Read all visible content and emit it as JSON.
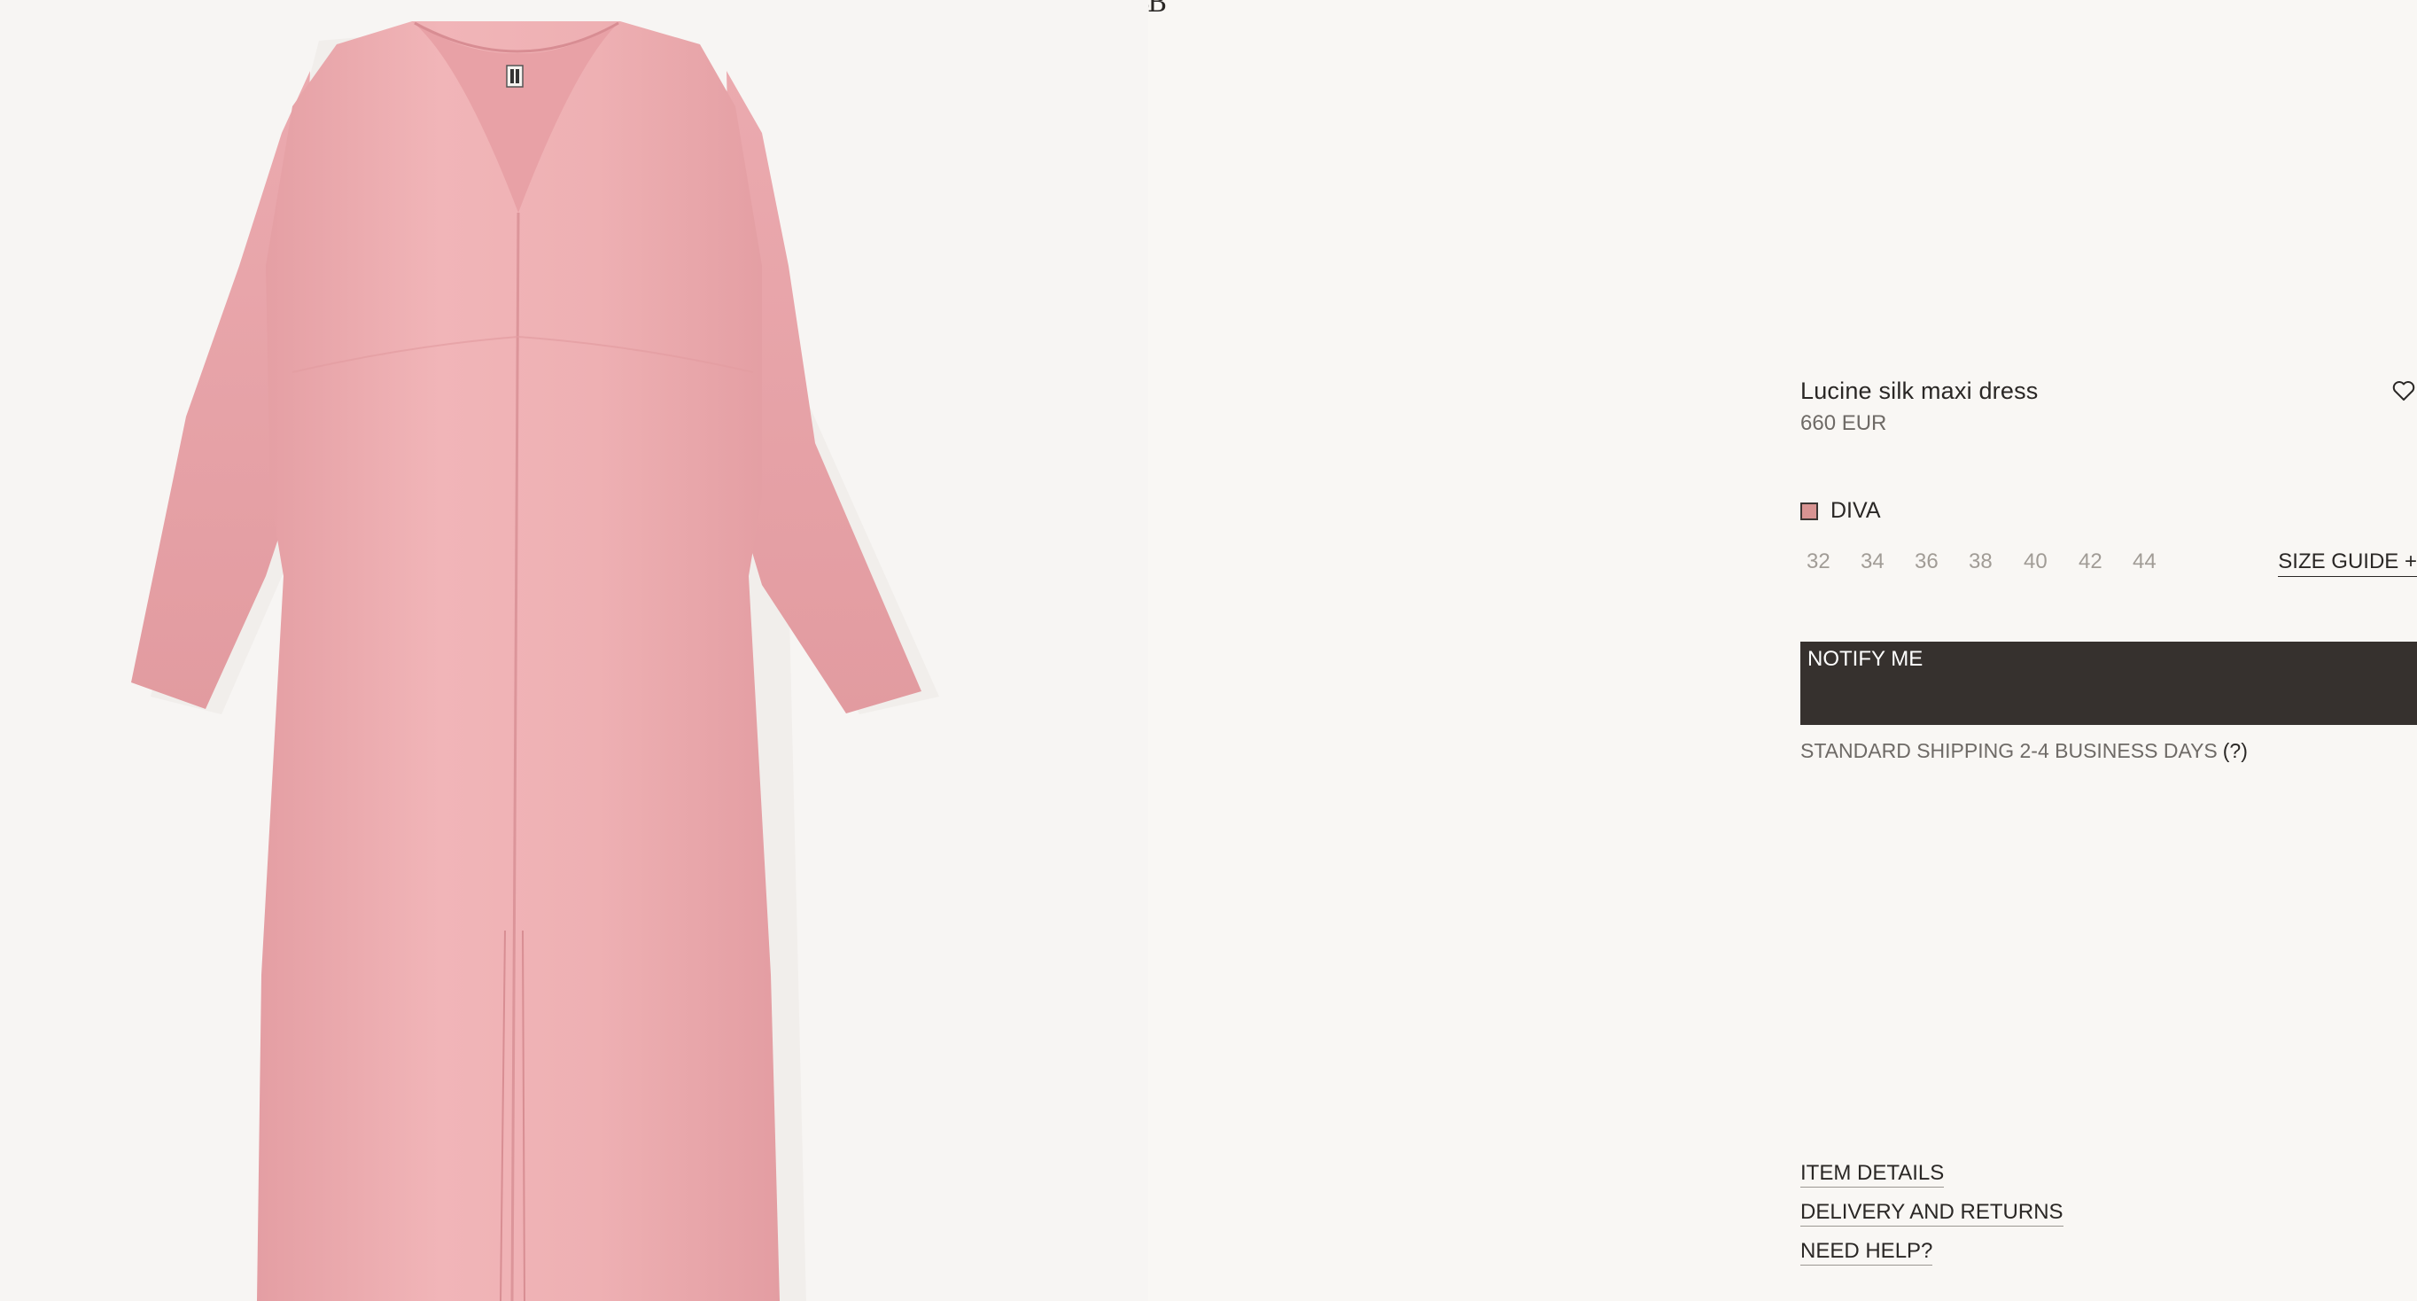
{
  "brand": {
    "logo_text": "BB"
  },
  "product": {
    "image_alt": "Pink silk maxi dress",
    "name": "Lucine silk maxi dress",
    "price": "660 EUR",
    "color": {
      "name": "DIVA",
      "swatch": "#d89392"
    },
    "sizes": [
      "32",
      "34",
      "36",
      "38",
      "40",
      "42",
      "44"
    ],
    "size_guide_label": "SIZE GUIDE +",
    "notify_label": "NOTIFY ME",
    "shipping_text": "STANDARD SHIPPING 2-4 BUSINESS DAYS",
    "shipping_help": "(?)"
  },
  "accordion": {
    "item_details": "ITEM DETAILS",
    "delivery_returns": "DELIVERY AND RETURNS",
    "need_help": "NEED HELP?"
  },
  "colors": {
    "background": "#f9f7f4",
    "button": "#36312e",
    "dress": "#eba9ad",
    "text_muted": "#6e6a66"
  },
  "icons": {
    "wishlist": "heart-outline-icon"
  }
}
